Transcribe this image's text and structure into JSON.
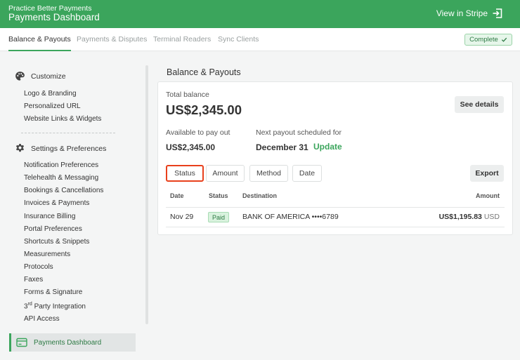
{
  "header": {
    "subtitle": "Practice Better Payments",
    "title": "Payments Dashboard",
    "view_stripe": "View in Stripe"
  },
  "tabs": [
    {
      "label": "Balance & Payouts",
      "active": true
    },
    {
      "label": "Payments & Disputes",
      "active": false
    },
    {
      "label": "Terminal Readers",
      "active": false
    },
    {
      "label": "Sync Clients",
      "active": false
    }
  ],
  "status_badge": {
    "label": "Complete"
  },
  "sidebar": {
    "customize": {
      "label": "Customize",
      "items": [
        "Logo & Branding",
        "Personalized URL",
        "Website Links & Widgets"
      ]
    },
    "settings": {
      "label": "Settings & Preferences",
      "items": [
        "Notification Preferences",
        "Telehealth & Messaging",
        "Bookings & Cancellations",
        "Invoices & Payments",
        "Insurance Billing",
        "Portal Preferences",
        "Shortcuts & Snippets",
        "Measurements",
        "Protocols",
        "Faxes",
        "Forms & Signature"
      ],
      "third_party": {
        "pre": "3",
        "sup": "rd",
        "post": " Party Integration"
      },
      "api_access": "API Access"
    },
    "payments_dashboard": "Payments Dashboard"
  },
  "main": {
    "title": "Balance & Payouts",
    "total_balance_label": "Total balance",
    "total_balance": "US$2,345.00",
    "see_details": "See details",
    "available_label": "Available to pay out",
    "available_value": "US$2,345.00",
    "next_payout_label": "Next payout scheduled for",
    "next_payout_value": "December 31",
    "update": "Update",
    "filters": [
      "Status",
      "Amount",
      "Method",
      "Date"
    ],
    "export": "Export",
    "table": {
      "headers": [
        "Date",
        "Status",
        "Destination",
        "Amount"
      ],
      "rows": [
        {
          "date": "Nov 29",
          "status": "Paid",
          "destination": "BANK OF AMERICA ••••6789",
          "amount": "US$1,195.83",
          "currency": "USD"
        }
      ]
    }
  },
  "colors": {
    "brand": "#3ba55c",
    "highlight": "#e8401c"
  }
}
